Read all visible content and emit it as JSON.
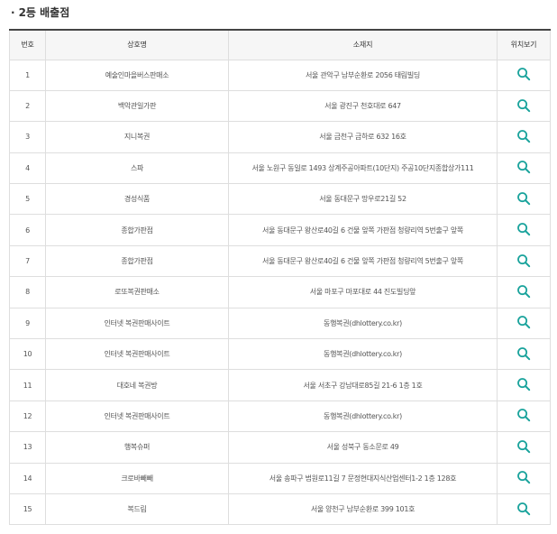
{
  "section": {
    "bullet": "·",
    "title": "2등 배출점"
  },
  "table": {
    "headers": [
      "번호",
      "상호명",
      "소재지",
      "위치보기"
    ],
    "rows": [
      {
        "no": "1",
        "name": "예술인마을버스판매소",
        "address": "서울 관악구 남부순환로 2056 태림빌딩"
      },
      {
        "no": "2",
        "name": "백악관일가판",
        "address": "서울 광진구 천호대로 647"
      },
      {
        "no": "3",
        "name": "지니복권",
        "address": "서울 금천구 금하로 632 16호"
      },
      {
        "no": "4",
        "name": "스파",
        "address": "서울 노원구 동일로 1493 상계주공아파트(10단지) 주공10단지종합상가111"
      },
      {
        "no": "5",
        "name": "경성식품",
        "address": "서울 동대문구 망우로21길 52"
      },
      {
        "no": "6",
        "name": "종합가판점",
        "address": "서울 동대문구 왕산로40길 6 건물 앞쪽 가판점 청량리역 5번출구 앞쪽"
      },
      {
        "no": "7",
        "name": "종합가판점",
        "address": "서울 동대문구 왕산로40길 6 건물 앞쪽 가판점 청량리역 5번출구 앞쪽"
      },
      {
        "no": "8",
        "name": "로또복권판매소",
        "address": "서울 마포구 마포대로 44 진도빌딩앞"
      },
      {
        "no": "9",
        "name": "인터넷 복권판매사이트",
        "address": "동행복권(dhlottery.co.kr)"
      },
      {
        "no": "10",
        "name": "인터넷 복권판매사이트",
        "address": "동행복권(dhlottery.co.kr)"
      },
      {
        "no": "11",
        "name": "대호네 복권방",
        "address": "서울 서초구 강남대로85길 21-6 1층 1호"
      },
      {
        "no": "12",
        "name": "인터넷 복권판매사이트",
        "address": "동행복권(dhlottery.co.kr)"
      },
      {
        "no": "13",
        "name": "행복슈퍼",
        "address": "서울 성북구 동소문로 49"
      },
      {
        "no": "14",
        "name": "크로바빼빼",
        "address": "서울 송파구 법원로11길 7 문정현대지식산업센터1-2 1층 128호"
      },
      {
        "no": "15",
        "name": "복드림",
        "address": "서울 양천구 남부순환로 399 101호"
      }
    ]
  },
  "icons": {
    "map": "search-icon"
  },
  "colors": {
    "icon": "#1aa39c",
    "header_bg": "#f6f6f6",
    "top_border": "#444444"
  }
}
